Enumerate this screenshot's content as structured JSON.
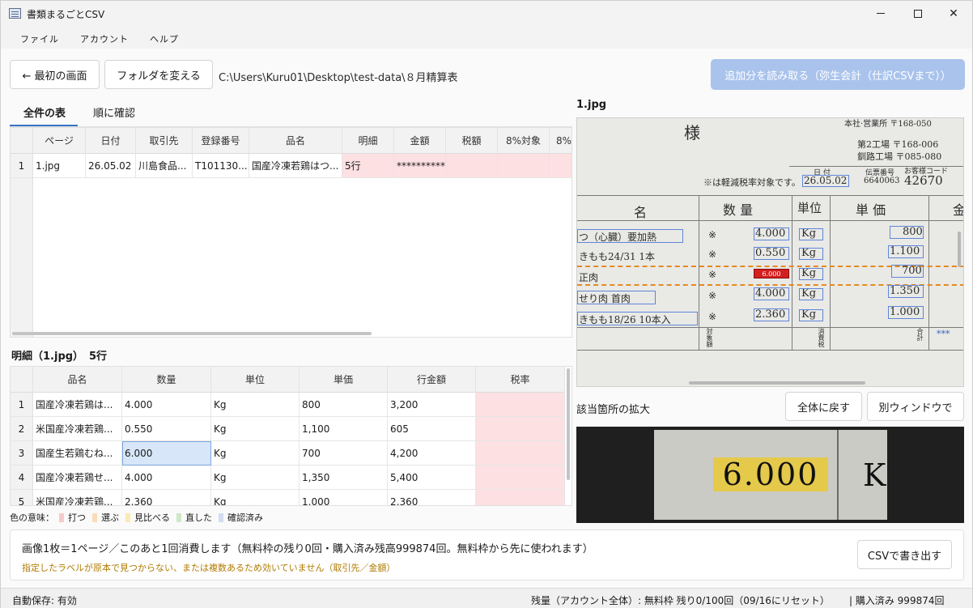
{
  "window": {
    "title": "書類まるごとCSV",
    "min": "—",
    "close": "✕"
  },
  "menu": [
    "ファイル",
    "アカウント",
    "ヘルプ"
  ],
  "toolbar": {
    "back_button": "← 最初の画面",
    "change_folder_button": "フォルダを変える",
    "path": "C:\\Users\\Kuru01\\Desktop\\test-data\\８月精算表",
    "read_more_button": "追加分を読み取る（弥生会計（仕訳CSVまで））"
  },
  "tabs": [
    {
      "label": "全件の表",
      "active": true
    },
    {
      "label": "順に確認",
      "active": false
    }
  ],
  "summary_table": {
    "columns": [
      "ページ",
      "日付",
      "取引先",
      "登録番号",
      "品名",
      "明細",
      "金額",
      "税額",
      "8%対象",
      "8%"
    ],
    "rows": [
      {
        "no": "1",
        "cells": [
          "1.jpg",
          "26.05.02",
          "川島食品...",
          "T101130...",
          "国産冷凍若鶏はつ...",
          "5行",
          "**********",
          "",
          "",
          ""
        ]
      }
    ]
  },
  "detail": {
    "title": "明細（1.jpg）",
    "count": "5行",
    "columns": [
      "品名",
      "数量",
      "単位",
      "単価",
      "行金額",
      "税率"
    ],
    "rows": [
      {
        "no": "1",
        "cells": [
          "国産冷凍若鶏は...",
          "4.000",
          "Kg",
          "800",
          "3,200",
          ""
        ]
      },
      {
        "no": "2",
        "cells": [
          "米国産冷凍若鶏...",
          "0.550",
          "Kg",
          "1,100",
          "605",
          ""
        ]
      },
      {
        "no": "3",
        "cells": [
          "国産生若鶏むね...",
          "6.000",
          "Kg",
          "700",
          "4,200",
          ""
        ]
      },
      {
        "no": "4",
        "cells": [
          "国産冷凍若鶏せ...",
          "4.000",
          "Kg",
          "1,350",
          "5,400",
          ""
        ]
      },
      {
        "no": "5",
        "cells": [
          "米国産冷凍若鶏...",
          "2.360",
          "Kg",
          "1,000",
          "2,360",
          ""
        ]
      }
    ]
  },
  "legend": {
    "label": "色の意味：",
    "items": [
      {
        "label": "打つ",
        "color": "#f7c9cc"
      },
      {
        "label": "選ぶ",
        "color": "#fbdcb8"
      },
      {
        "label": "見比べる",
        "color": "#fbeab4"
      },
      {
        "label": "直した",
        "color": "#cfe8c8"
      },
      {
        "label": "確認済み",
        "color": "#d3dcf0"
      }
    ]
  },
  "image_pane": {
    "filename": "1.jpg",
    "zoom_label": "該当箇所の拡大",
    "reset_button": "全体に戻す",
    "new_window_button": "別ウィンドウで",
    "zoom_value": "6.000",
    "zoom_unit": "K"
  },
  "document": {
    "sama": "様",
    "header_right1": "本社·営業所 〒168-050",
    "header_right2": "第2工場 〒168-006",
    "header_right3": "釧路工場 〒085-080",
    "tax_note": "※は軽減税率対象です。",
    "date_label": "日 付",
    "date_value": "26.05.02",
    "slip_label": "伝票番号",
    "slip_value": "6640063",
    "code_label": "お客様コード",
    "code_value": "42670",
    "col_name": "名",
    "col_qty": "数 量",
    "col_unit": "単位",
    "col_price": "単 価",
    "col_amount": "金",
    "lines": [
      {
        "name": "つ（心臓）要加熱",
        "qty": "4.000",
        "unit": "Kg",
        "price": "800"
      },
      {
        "name": "きもも24/31 1本",
        "qty": "0.550",
        "unit": "Kg",
        "price": "1.100"
      },
      {
        "name": "正肉",
        "qty": "6.000",
        "unit": "Kg",
        "price": "700"
      },
      {
        "name": "せり肉 首肉",
        "qty": "4.000",
        "unit": "Kg",
        "price": "1.350"
      },
      {
        "name": "きもも18/26 10本入",
        "qty": "2.360",
        "unit": "Kg",
        "price": "1.000"
      }
    ],
    "mark": "※",
    "footer_a": "対象額",
    "footer_b": "消費税",
    "footer_c": "合計",
    "footer_d": "***"
  },
  "footer": {
    "main": "画像1枚＝1ページ／このあと1回消費します（無料枠の残り0回・購入済み残高999874回。無料枠から先に使われます）",
    "warning": "指定したラベルが原本で見つからない、または複数あるため効いていません（取引先／金額）",
    "export_button": "CSVで書き出す"
  },
  "status": {
    "autosave": "自動保存: 有効",
    "remaining": "残量（アカウント全体）: 無料枠 残り0/100回（09/16にリセット）",
    "purchased": "| 購入済み 999874回"
  }
}
